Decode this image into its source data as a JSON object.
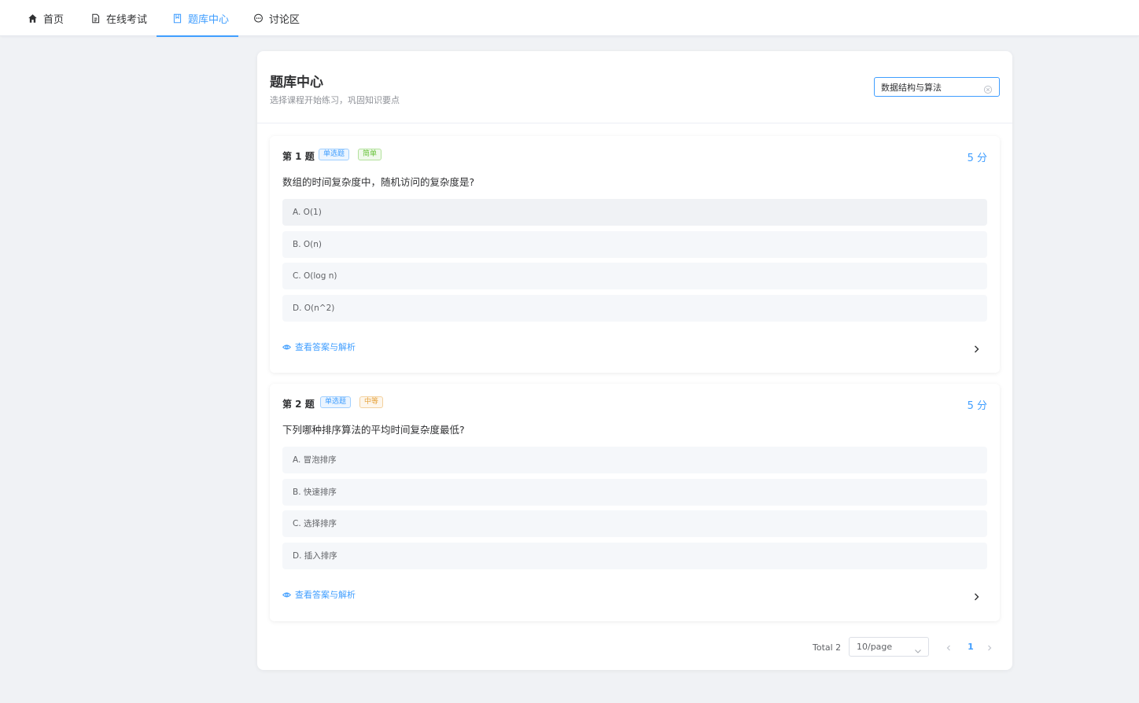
{
  "nav": {
    "items": [
      {
        "label": "首页",
        "icon": "home-icon"
      },
      {
        "label": "在线考试",
        "icon": "document-icon"
      },
      {
        "label": "题库中心",
        "icon": "book-icon",
        "active": true
      },
      {
        "label": "讨论区",
        "icon": "chat-icon"
      }
    ]
  },
  "header": {
    "title": "题库中心",
    "subtitle": "选择课程开始练习，巩固知识要点"
  },
  "search": {
    "value": "数据结构与算法",
    "placeholder": ""
  },
  "questions": [
    {
      "number": "第 1 题",
      "type_tag": "单选题",
      "difficulty_tag": "简单",
      "score": "5 分",
      "text": "数组的时间复杂度中，随机访问的复杂度是?",
      "options": [
        "A. O(1)",
        "B. O(n)",
        "C. O(log n)",
        "D. O(n^2)"
      ],
      "answer_link": "查看答案与解析"
    },
    {
      "number": "第 2 题",
      "type_tag": "单选题",
      "difficulty_tag": "中等",
      "score": "5 分",
      "text": "下列哪种排序算法的平均时间复杂度最低?",
      "options": [
        "A. 冒泡排序",
        "B. 快速排序",
        "C. 选择排序",
        "D. 插入排序"
      ],
      "answer_link": "查看答案与解析"
    }
  ],
  "pagination": {
    "total": "Total 2",
    "page_size": "10/page",
    "current_page": "1"
  },
  "colors": {
    "accent": "#409eff",
    "easy": "#67c23a",
    "medium": "#e6a23c",
    "background": "#f0f2f5"
  }
}
